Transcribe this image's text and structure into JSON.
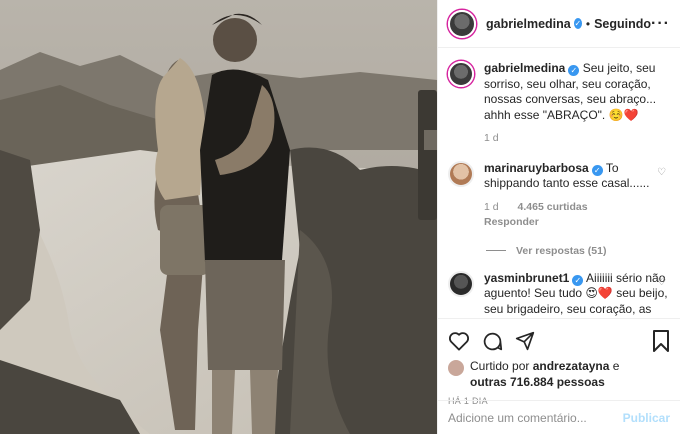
{
  "post": {
    "username": "gabrielmedina",
    "follow_state": "Seguindo",
    "more_icon": "more-options-icon",
    "caption": "Seu jeito, seu sorriso, seu olhar, seu coração, nossas conversas, seu abraço... ahhh esse \"ABRAÇO\". ☺️❤️",
    "caption_age": "1 d"
  },
  "comments": [
    {
      "username": "marinaruybarbosa",
      "text": "To shippando tanto esse casal......",
      "age": "1 d",
      "likes": "4.465 curtidas",
      "reply_label": "Responder",
      "view_replies": "Ver respostas (51)"
    },
    {
      "username": "yasminbrunet1",
      "text": "Aiiiiiii sério não aguento! Seu tudo 😍❤️ seu beijo, seu brigadeiro, seu coração, as conversas de horas, seus olhos, ainnnn seu abraço ❤️"
    }
  ],
  "liked_by": {
    "prefix": "Curtido por",
    "user": "andrezatayna",
    "conjunction": "e",
    "others": "outras 716.884 pessoas"
  },
  "time_ago": "HÁ 1 DIA",
  "add_comment": {
    "placeholder": "Adicione um comentário...",
    "publish": "Publicar"
  },
  "colors": {
    "verified": "#3897f0",
    "publish_disabled": "#b2dffc",
    "muted": "#8e8e8e"
  }
}
